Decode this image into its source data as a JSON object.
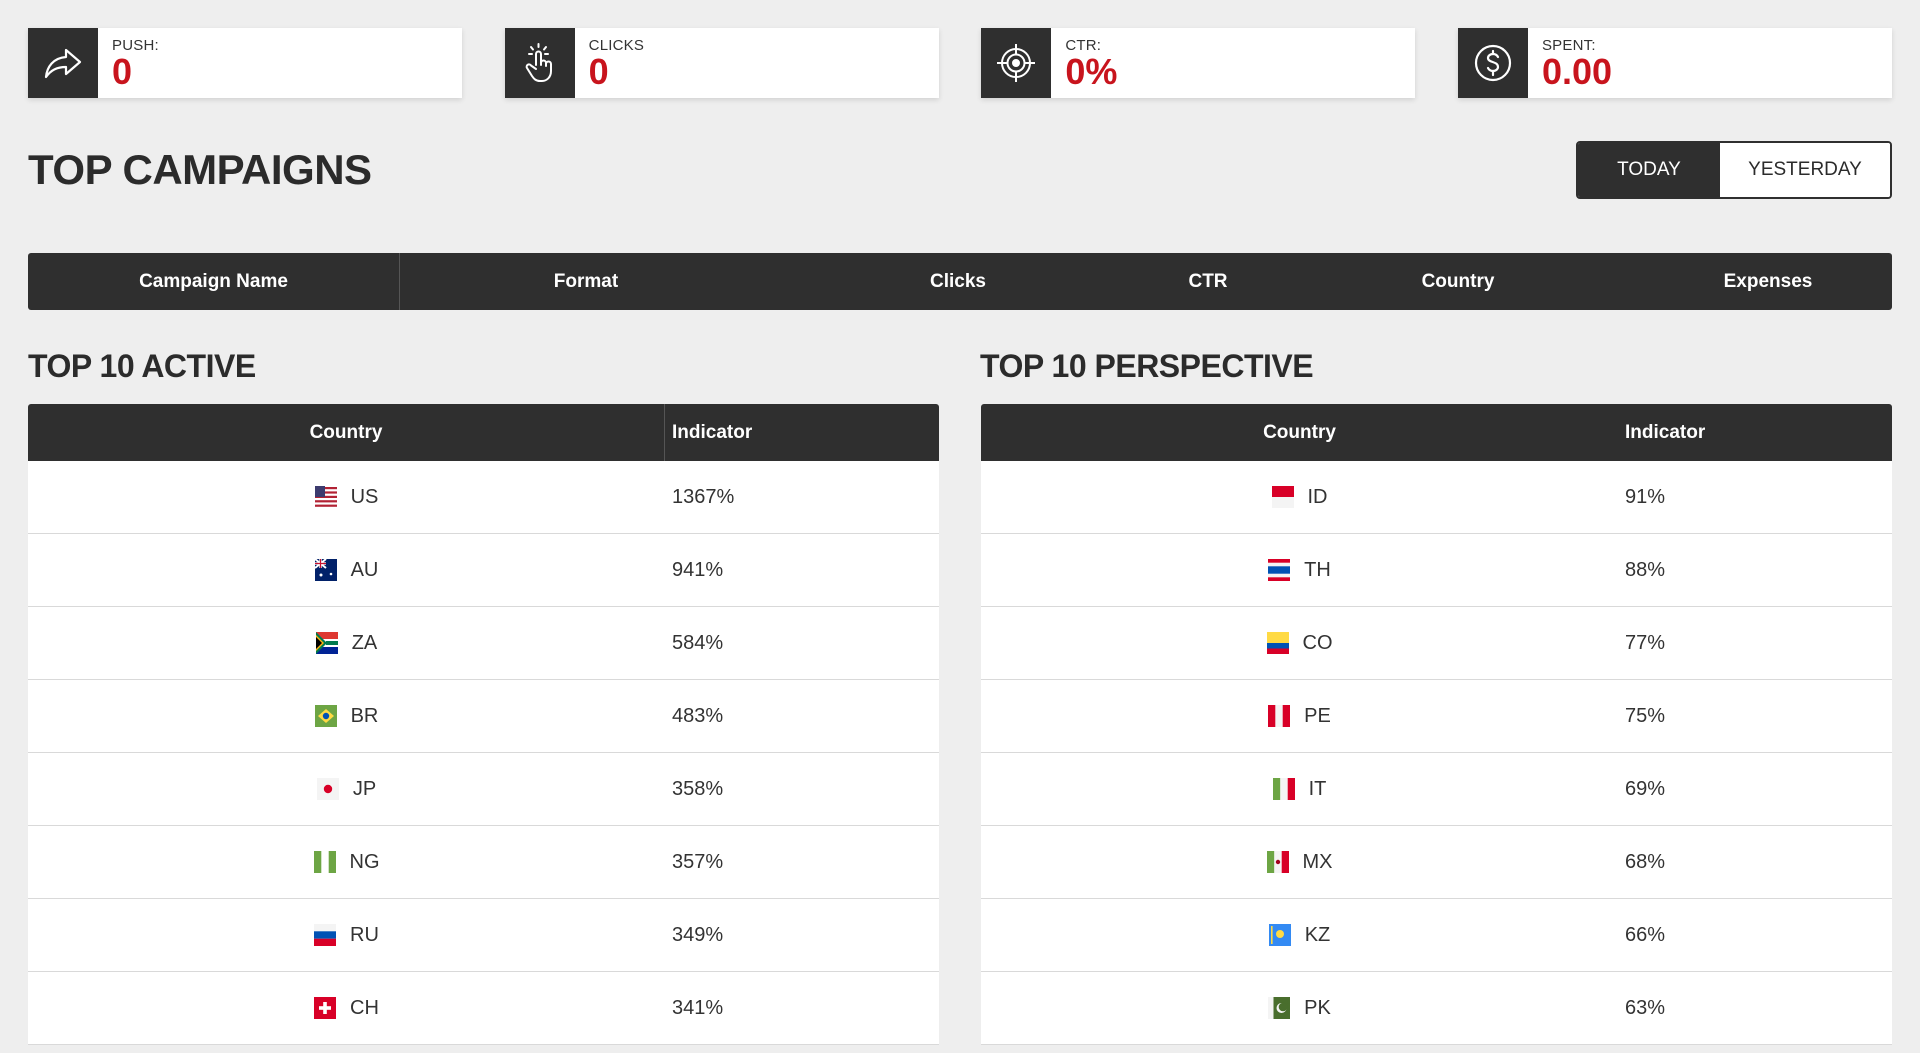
{
  "stats": [
    {
      "label": "PUSH:",
      "value": "0",
      "icon": "share-arrow-icon"
    },
    {
      "label": "CLICKS",
      "value": "0",
      "icon": "tap-hand-icon"
    },
    {
      "label": "CTR:",
      "value": "0%",
      "icon": "target-icon"
    },
    {
      "label": "SPENT:",
      "value": "0.00",
      "icon": "dollar-circle-icon"
    }
  ],
  "top_campaigns": {
    "title": "TOP CAMPAIGNS",
    "toggle": {
      "today": "TODAY",
      "yesterday": "YESTERDAY",
      "selected": "TODAY"
    },
    "columns": [
      "Campaign Name",
      "Format",
      "Clicks",
      "CTR",
      "Country",
      "Expenses"
    ]
  },
  "top_active": {
    "title": "TOP 10 ACTIVE",
    "columns": [
      "Country",
      "Indicator"
    ],
    "rows": [
      {
        "country": "US",
        "indicator": "1367%"
      },
      {
        "country": "AU",
        "indicator": "941%"
      },
      {
        "country": "ZA",
        "indicator": "584%"
      },
      {
        "country": "BR",
        "indicator": "483%"
      },
      {
        "country": "JP",
        "indicator": "358%"
      },
      {
        "country": "NG",
        "indicator": "357%"
      },
      {
        "country": "RU",
        "indicator": "349%"
      },
      {
        "country": "CH",
        "indicator": "341%"
      }
    ]
  },
  "top_perspective": {
    "title": "TOP 10 PERSPECTIVE",
    "columns": [
      "Country",
      "Indicator"
    ],
    "rows": [
      {
        "country": "ID",
        "indicator": "91%"
      },
      {
        "country": "TH",
        "indicator": "88%"
      },
      {
        "country": "CO",
        "indicator": "77%"
      },
      {
        "country": "PE",
        "indicator": "75%"
      },
      {
        "country": "IT",
        "indicator": "69%"
      },
      {
        "country": "MX",
        "indicator": "68%"
      },
      {
        "country": "KZ",
        "indicator": "66%"
      },
      {
        "country": "PK",
        "indicator": "63%"
      }
    ]
  },
  "colors": {
    "accent": "#c8141d",
    "dark": "#2f2f2f",
    "background": "#eeeeee"
  }
}
